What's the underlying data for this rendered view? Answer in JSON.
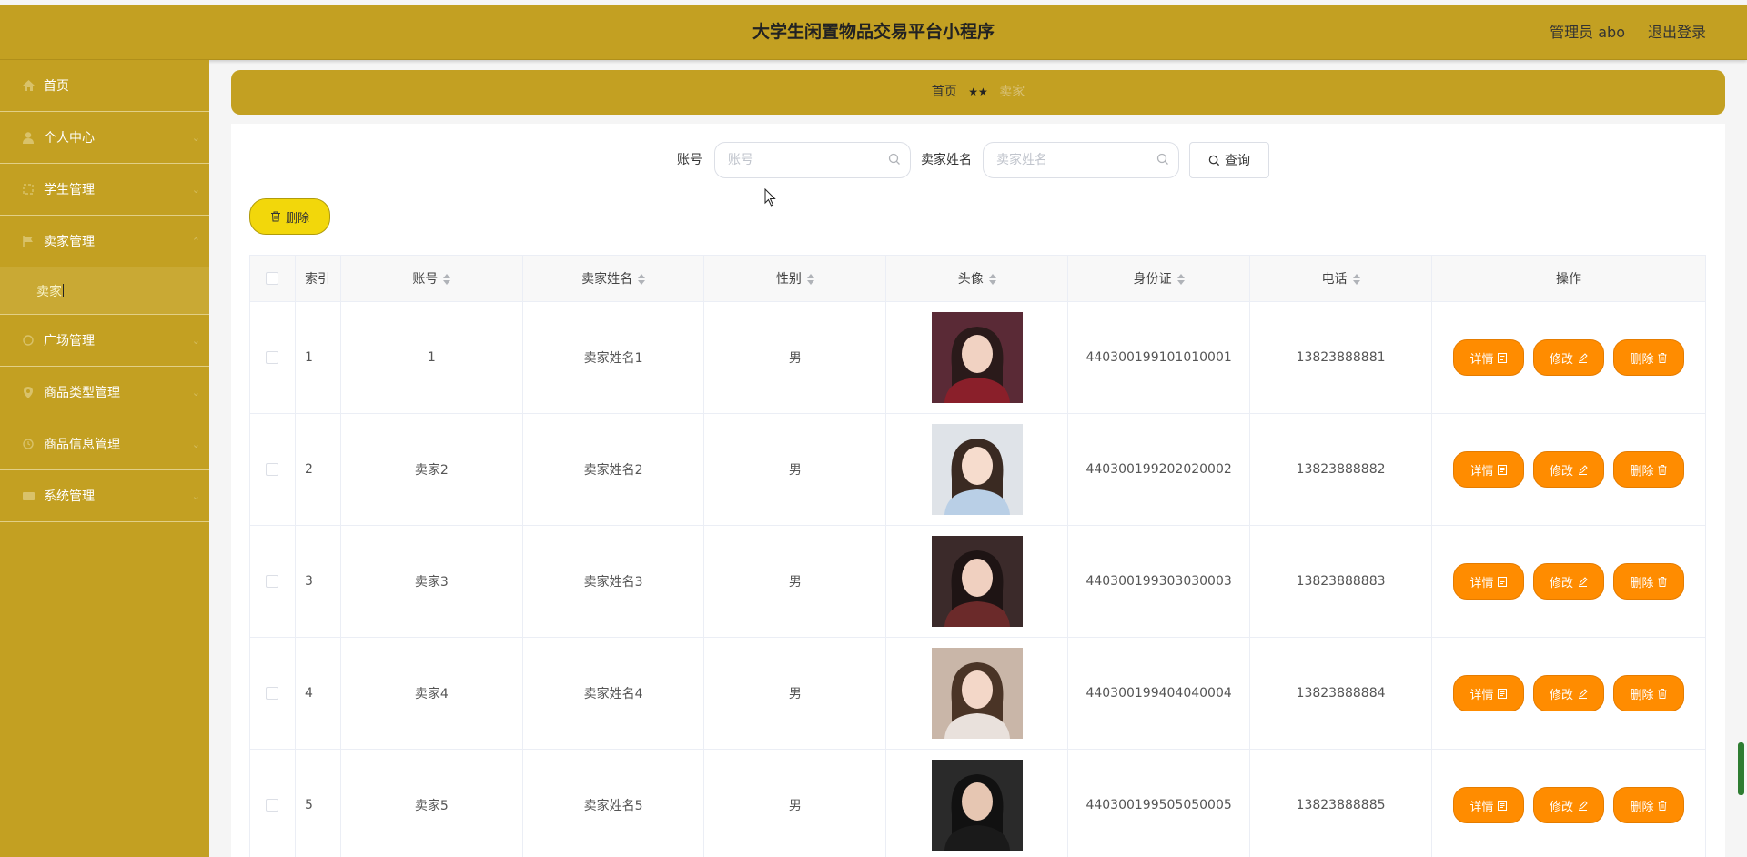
{
  "header": {
    "title": "大学生闲置物品交易平台小程序",
    "user": "管理员 abo",
    "logout": "退出登录"
  },
  "sidebar": {
    "items": [
      {
        "label": "首页",
        "icon": "home-icon"
      },
      {
        "label": "个人中心",
        "icon": "user-icon"
      },
      {
        "label": "学生管理",
        "icon": "student-icon"
      },
      {
        "label": "卖家管理",
        "icon": "flag-icon"
      },
      {
        "label": "广场管理",
        "icon": "square-icon"
      },
      {
        "label": "商品类型管理",
        "icon": "location-icon"
      },
      {
        "label": "商品信息管理",
        "icon": "info-icon"
      },
      {
        "label": "系统管理",
        "icon": "system-icon"
      }
    ],
    "sub_item": "卖家"
  },
  "breadcrumb": {
    "home": "首页",
    "separator": "★★",
    "current": "卖家"
  },
  "search": {
    "account_label": "账号",
    "account_placeholder": "账号",
    "name_label": "卖家姓名",
    "name_placeholder": "卖家姓名",
    "query_button": "查询"
  },
  "toolbar": {
    "delete_button": "删除"
  },
  "table": {
    "columns": [
      "索引",
      "账号",
      "卖家姓名",
      "性别",
      "头像",
      "身份证",
      "电话",
      "操作"
    ],
    "rows": [
      {
        "index": "1",
        "account": "1",
        "name": "卖家姓名1",
        "gender": "男",
        "id_card": "440300199101010001",
        "phone": "13823888881"
      },
      {
        "index": "2",
        "account": "卖家2",
        "name": "卖家姓名2",
        "gender": "男",
        "id_card": "440300199202020002",
        "phone": "13823888882"
      },
      {
        "index": "3",
        "account": "卖家3",
        "name": "卖家姓名3",
        "gender": "男",
        "id_card": "440300199303030003",
        "phone": "13823888883"
      },
      {
        "index": "4",
        "account": "卖家4",
        "name": "卖家姓名4",
        "gender": "男",
        "id_card": "440300199404040004",
        "phone": "13823888884"
      },
      {
        "index": "5",
        "account": "卖家5",
        "name": "卖家姓名5",
        "gender": "男",
        "id_card": "440300199505050005",
        "phone": "13823888885"
      }
    ],
    "actions": {
      "detail": "详情",
      "edit": "修改",
      "delete": "删除"
    }
  },
  "colors": {
    "theme": "#c3a022",
    "action_button": "#ff8c00",
    "delete_button": "#f2d70b"
  }
}
